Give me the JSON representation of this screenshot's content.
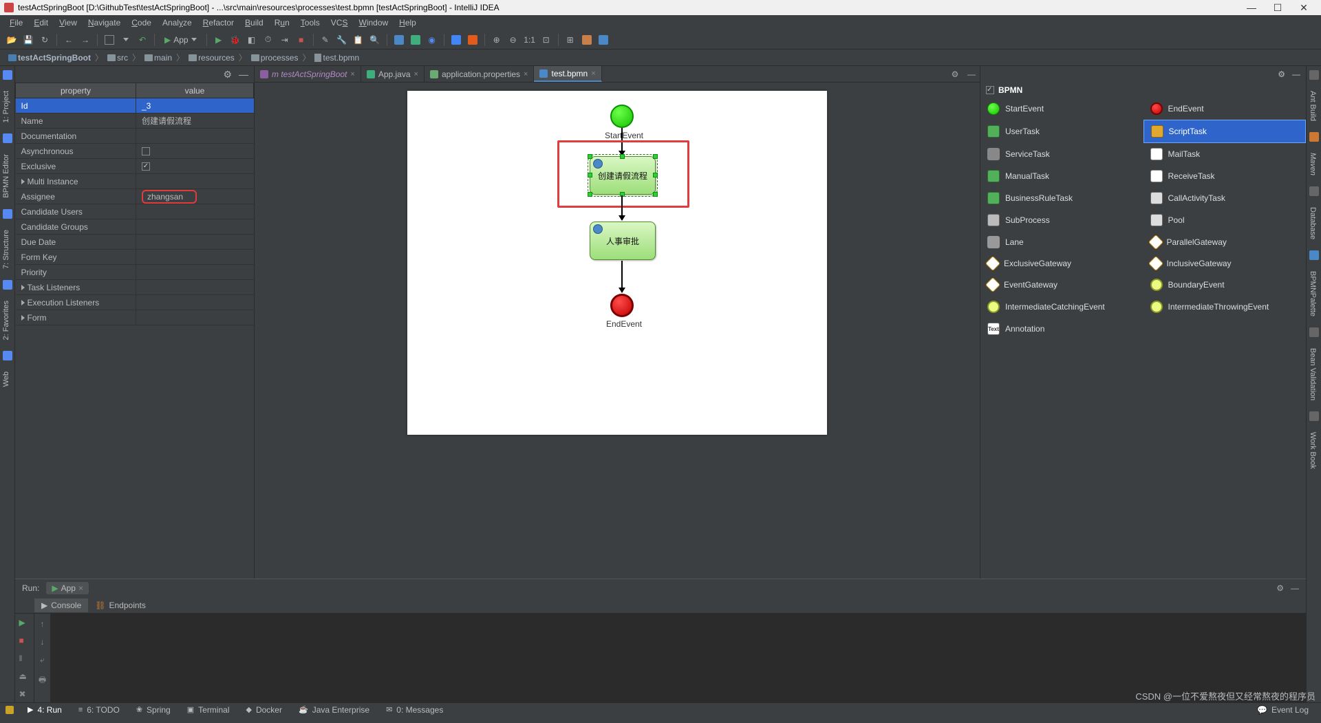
{
  "title": "testActSpringBoot [D:\\GithubTest\\testActSpringBoot] - ...\\src\\main\\resources\\processes\\test.bpmn [testActSpringBoot] - IntelliJ IDEA",
  "window_controls": {
    "min": "—",
    "max": "☐",
    "close": "✕"
  },
  "menus": [
    "File",
    "Edit",
    "View",
    "Navigate",
    "Code",
    "Analyze",
    "Refactor",
    "Build",
    "Run",
    "Tools",
    "VCS",
    "Window",
    "Help"
  ],
  "menu_underline_index": [
    0,
    0,
    0,
    0,
    0,
    4,
    0,
    0,
    1,
    0,
    2,
    0,
    0
  ],
  "run_config": {
    "label": "App"
  },
  "toolbar_ratio": "1:1",
  "breadcrumb": [
    {
      "icon": "module",
      "label": "testActSpringBoot"
    },
    {
      "icon": "folder",
      "label": "src"
    },
    {
      "icon": "folder",
      "label": "main"
    },
    {
      "icon": "folder",
      "label": "resources"
    },
    {
      "icon": "folder",
      "label": "processes"
    },
    {
      "icon": "file",
      "label": "test.bpmn"
    }
  ],
  "left_stripe": [
    {
      "id": "project",
      "label": "1: Project",
      "icon": "c-blue"
    },
    {
      "id": "bpmn-editor",
      "label": "BPMN Editor",
      "icon": "c-teal"
    },
    {
      "id": "structure",
      "label": "7: Structure",
      "icon": "c-gray"
    },
    {
      "id": "favorites",
      "label": "2: Favorites",
      "icon": "c-orange"
    },
    {
      "id": "web",
      "label": "Web",
      "icon": "c-gray"
    }
  ],
  "right_stripe": [
    {
      "id": "ant",
      "label": "Ant Build"
    },
    {
      "id": "maven",
      "label": "Maven",
      "italic": true,
      "color": "#cc7832"
    },
    {
      "id": "database",
      "label": "Database"
    },
    {
      "id": "palette",
      "label": "BPMNPalette",
      "active": true,
      "color": "#4a88c7"
    },
    {
      "id": "bean",
      "label": "Bean Validation"
    },
    {
      "id": "workbook",
      "label": "Work Book"
    }
  ],
  "props_header": {
    "property": "property",
    "value": "value"
  },
  "properties": [
    {
      "k": "Id",
      "v": "_3",
      "sel": true
    },
    {
      "k": "Name",
      "v": "创建请假流程"
    },
    {
      "k": "Documentation",
      "v": ""
    },
    {
      "k": "Asynchronous",
      "v": "",
      "chk": false
    },
    {
      "k": "Exclusive",
      "v": "",
      "chk": true
    },
    {
      "k": "Multi Instance",
      "v": "",
      "expand": true
    },
    {
      "k": "Assignee",
      "v": "zhangsan",
      "red": true
    },
    {
      "k": "Candidate Users",
      "v": ""
    },
    {
      "k": "Candidate Groups",
      "v": ""
    },
    {
      "k": "Due Date",
      "v": ""
    },
    {
      "k": "Form Key",
      "v": ""
    },
    {
      "k": "Priority",
      "v": ""
    },
    {
      "k": "Task Listeners",
      "v": "",
      "expand": true
    },
    {
      "k": "Execution Listeners",
      "v": "",
      "expand": true
    },
    {
      "k": "Form",
      "v": "",
      "expand": true
    }
  ],
  "tabs": [
    {
      "id": "proj",
      "label": "testActSpringBoot",
      "icon": "#8a5fa0",
      "italic": true,
      "prefix": "m "
    },
    {
      "id": "app",
      "label": "App.java",
      "icon": "#3eaf7c"
    },
    {
      "id": "props",
      "label": "application.properties",
      "icon": "#6aab73"
    },
    {
      "id": "bpmn",
      "label": "test.bpmn",
      "icon": "#4a88c7",
      "active": true
    }
  ],
  "canvas": {
    "start_label": "StartEvent",
    "end_label": "EndEvent",
    "task1": "创建请假流程",
    "task2": "人事审批"
  },
  "palette": {
    "header": "BPMN",
    "checked": true,
    "items": [
      {
        "l": "StartEvent",
        "ic": "ic-start"
      },
      {
        "l": "EndEvent",
        "ic": "ic-end"
      },
      {
        "l": "UserTask",
        "ic": "ic-box"
      },
      {
        "l": "ScriptTask",
        "ic": "ic-script",
        "sel": true
      },
      {
        "l": "ServiceTask",
        "ic": "ic-gear"
      },
      {
        "l": "MailTask",
        "ic": "ic-mail"
      },
      {
        "l": "ManualTask",
        "ic": "ic-box"
      },
      {
        "l": "ReceiveTask",
        "ic": "ic-mail"
      },
      {
        "l": "BusinessRuleTask",
        "ic": "ic-box"
      },
      {
        "l": "CallActivityTask",
        "ic": "ic-pool"
      },
      {
        "l": "SubProcess",
        "ic": "ic-sub"
      },
      {
        "l": "Pool",
        "ic": "ic-pool"
      },
      {
        "l": "Lane",
        "ic": "ic-lane"
      },
      {
        "l": "ParallelGateway",
        "ic": "ic-gate"
      },
      {
        "l": "ExclusiveGateway",
        "ic": "ic-gate"
      },
      {
        "l": "InclusiveGateway",
        "ic": "ic-gate"
      },
      {
        "l": "EventGateway",
        "ic": "ic-gate"
      },
      {
        "l": "BoundaryEvent",
        "ic": "ic-ev"
      },
      {
        "l": "IntermediateCatchingEvent",
        "ic": "ic-ev"
      },
      {
        "l": "IntermediateThrowingEvent",
        "ic": "ic-ev"
      },
      {
        "l": "Annotation",
        "ic": "ic-text"
      }
    ]
  },
  "run_panel": {
    "header": "Run:",
    "tab": "App",
    "subtabs": [
      {
        "l": "Console",
        "ic": "▶"
      },
      {
        "l": "Endpoints",
        "ic": "⛓"
      }
    ]
  },
  "bottom_tabs": [
    {
      "l": "4: Run",
      "ic": "▶",
      "active": true
    },
    {
      "l": "6: TODO",
      "ic": "≡"
    },
    {
      "l": "Spring",
      "ic": "❀"
    },
    {
      "l": "Terminal",
      "ic": "▣"
    },
    {
      "l": "Docker",
      "ic": "◆"
    },
    {
      "l": "Java Enterprise",
      "ic": "☕"
    },
    {
      "l": "0: Messages",
      "ic": "✉"
    }
  ],
  "event_log": "Event Log",
  "watermark": "CSDN @一位不爱熬夜但又经常熬夜的程序员"
}
